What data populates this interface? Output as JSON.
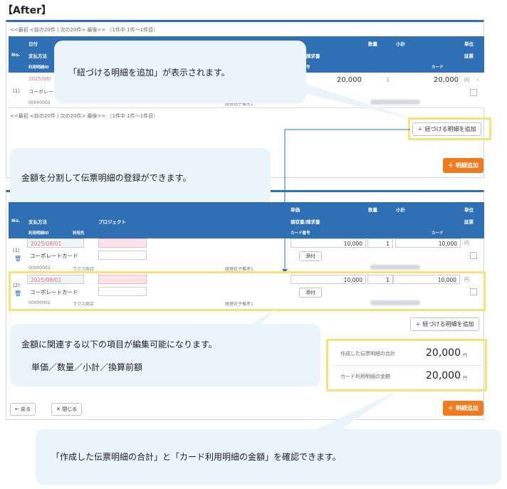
{
  "heading": "【After】",
  "pager": "<<最初 <前の20件 | 次の20件> 最後>> （1件中 1件～1件目）",
  "top_headers": {
    "date": "日付",
    "method": "支払方法",
    "detail_id": "利用明細ID",
    "no": "No.",
    "price": "単価",
    "qty": "数量",
    "subtotal": "小計",
    "unit": "単位",
    "receipt": "領収書/請求書",
    "evidence": "証票",
    "card_no": "カード番号",
    "card": "カード"
  },
  "top_row": {
    "no": "(1)",
    "date": "2025/08/",
    "method": "コーポレート",
    "detail_id": "00000002",
    "price": "20,000",
    "qty": "1",
    "subtotal": "20,000",
    "unit": "円",
    "memo": "経理花子備考1"
  },
  "link_button": "＋ 紐づける明細を追加",
  "add_button": "＋ 明細追加",
  "callout1": "「紐づける明細を追加」が表示されます。",
  "callout2": "金額を分割して伝票明細の登録ができます。",
  "callout3_line1": "金額に関連する以下の項目が編集可能になります。",
  "callout3_line2": "単価／数量／小計／換算前額",
  "callout4": "「作成した伝票明細の合計」と「カード利用明細の金額」を確認できます。",
  "bottom_headers": {
    "no": "No.",
    "method": "支払方法",
    "project": "プロジェクト",
    "detail_id": "利用明細ID",
    "shop": "利用先",
    "price": "単価",
    "qty": "数量",
    "subtotal": "小計",
    "unit": "単位",
    "receipt": "領収書/請求書",
    "evidence": "証票",
    "card_no": "カード番号",
    "card": "カード"
  },
  "rows": [
    {
      "no": "(1)",
      "date": "2025/08/01",
      "method": "コーポレートカード",
      "detail_id": "00000002",
      "shop": "ラクス商店",
      "price": "10,000",
      "qty": "1",
      "subtotal": "10,000",
      "unit": "円",
      "attach": "添付",
      "memo": "経理花子備考1"
    },
    {
      "no": "(2)",
      "date": "2025/08/01",
      "method": "コーポレートカード",
      "detail_id": "00000002",
      "shop": "ラクス商店",
      "price": "10,000",
      "qty": "1",
      "subtotal": "10,000",
      "unit": "円",
      "attach": "添付",
      "memo": "経理花子備考1"
    }
  ],
  "totals": {
    "created_label": "作成した伝票明細の合計",
    "created_value": "20,000",
    "card_label": "カード利用明細の金額",
    "card_value": "20,000",
    "unit": "円"
  },
  "back_button": "← 戻る",
  "close_button": "✕ 閉じる",
  "colors": {
    "header": "#2f6fb3",
    "highlight": "#f7e27a",
    "callout": "#eaf4fb",
    "orange": "#f07b1e"
  }
}
